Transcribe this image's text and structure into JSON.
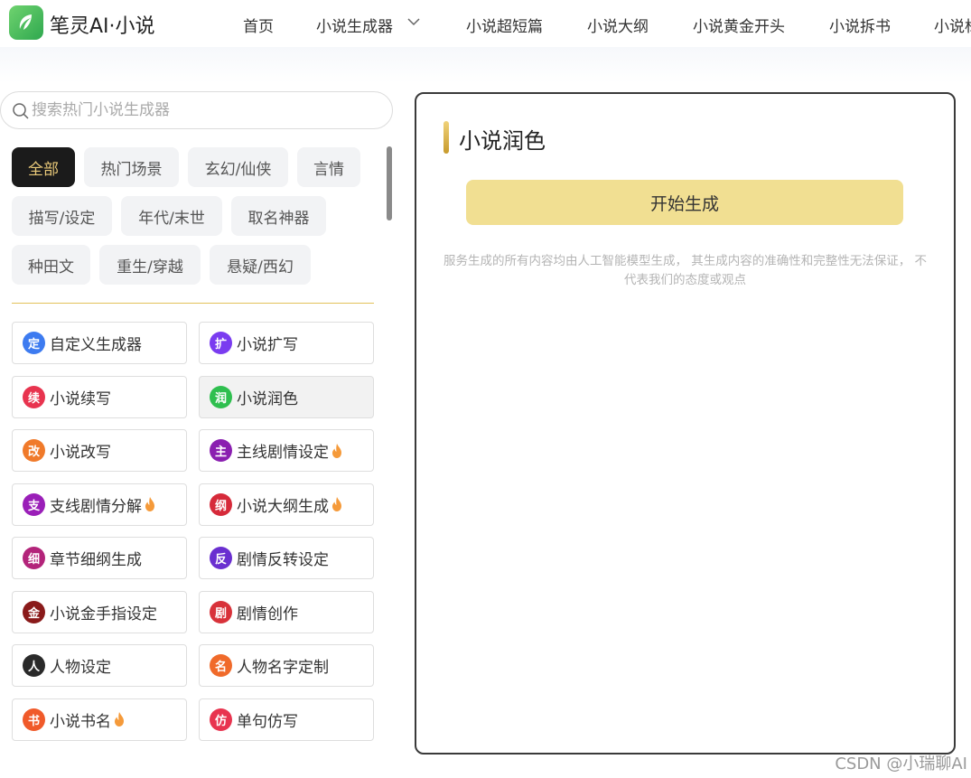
{
  "header": {
    "logo_text": "笔灵AI·小说",
    "nav": [
      "首页",
      "小说生成器",
      "小说超短篇",
      "小说大纲",
      "小说黄金开头",
      "小说拆书",
      "小说标"
    ]
  },
  "sidebar": {
    "search_placeholder": "搜索热门小说生成器",
    "tags": [
      "全部",
      "热门场景",
      "玄幻/仙侠",
      "言情",
      "描写/设定",
      "年代/末世",
      "取名神器",
      "种田文",
      "重生/穿越",
      "悬疑/西幻"
    ],
    "active_tag": "全部",
    "cards": [
      {
        "label": "自定义生成器",
        "icon": "定",
        "icon_color": "#3d7bf0"
      },
      {
        "label": "小说扩写",
        "icon": "扩",
        "icon_color": "#7a3cf0"
      },
      {
        "label": "小说续写",
        "icon": "续",
        "icon_color": "#e8344f"
      },
      {
        "label": "小说润色",
        "icon": "润",
        "icon_color": "#2fbf4f",
        "active": true
      },
      {
        "label": "小说改写",
        "icon": "改",
        "icon_color": "#f07a2a"
      },
      {
        "label": "主线剧情设定",
        "icon": "主",
        "icon_color": "#8a1fb0",
        "hot": true
      },
      {
        "label": "支线剧情分解",
        "icon": "支",
        "icon_color": "#9a1fb8",
        "hot": true
      },
      {
        "label": "小说大纲生成",
        "icon": "纲",
        "icon_color": "#d62a3a",
        "hot": true
      },
      {
        "label": "章节细纲生成",
        "icon": "细",
        "icon_color": "#b3247a"
      },
      {
        "label": "剧情反转设定",
        "icon": "反",
        "icon_color": "#6a2fd0"
      },
      {
        "label": "小说金手指设定",
        "icon": "金",
        "icon_color": "#8a1a1a"
      },
      {
        "label": "剧情创作",
        "icon": "剧",
        "icon_color": "#d8323a"
      },
      {
        "label": "人物设定",
        "icon": "人",
        "icon_color": "#2a2a2a"
      },
      {
        "label": "人物名字定制",
        "icon": "名",
        "icon_color": "#f06a2a"
      },
      {
        "label": "小说书名",
        "icon": "书",
        "icon_color": "#f05a2a",
        "hot": true
      },
      {
        "label": "单句仿写",
        "icon": "仿",
        "icon_color": "#e8344f"
      }
    ]
  },
  "panel": {
    "title": "小说润色",
    "generate_label": "开始生成",
    "disclaimer": "服务生成的所有内容均由人工智能模型生成， 其生成内容的准确性和完整性无法保证， 不代表我们的态度或观点"
  },
  "watermark": "CSDN @小瑞聊AI",
  "colors": {
    "accent_gold": "#f1df92",
    "active_tag_bg": "#1b1b1b",
    "active_tag_text": "#e9c979"
  }
}
